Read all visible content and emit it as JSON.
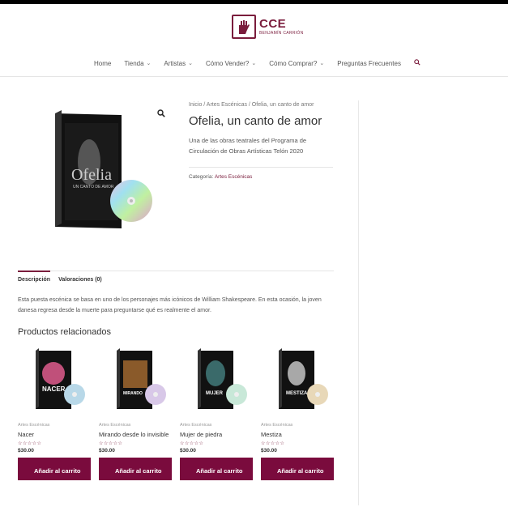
{
  "brand": {
    "name": "CCE",
    "sub": "BENJAMÍN CARRIÓN",
    "accent": "#7a1c3c"
  },
  "nav": {
    "items": [
      {
        "label": "Home",
        "dropdown": false
      },
      {
        "label": "Tienda",
        "dropdown": true
      },
      {
        "label": "Artistas",
        "dropdown": true
      },
      {
        "label": "Cómo Vender?",
        "dropdown": true
      },
      {
        "label": "Cómo Comprar?",
        "dropdown": true
      },
      {
        "label": "Preguntas Frecuentes",
        "dropdown": false
      }
    ],
    "search_icon": "search-icon"
  },
  "product": {
    "breadcrumb": "Inicio / Artes Escénicas / Ofelia, un canto de amor",
    "title": "Ofelia, un canto de amor",
    "short_description": "Una de las obras teatrales del Programa de Circulación de Obras Artísticas Telón 2020",
    "category_label": "Categoría:",
    "category": "Artes Escénicas",
    "image_title": "Ofelia",
    "image_subtitle": "UN CANTO DE AMOR"
  },
  "tabs": [
    {
      "label": "Descripción",
      "active": true
    },
    {
      "label": "Valoraciones (0)",
      "active": false
    }
  ],
  "description": "Esta puesta escénica se basa en uno de los personajes más icónicos de William Shakespeare. En esta ocasión, la joven danesa regresa desde la muerte para preguntarse qué es realmente el amor.",
  "related": {
    "title": "Productos relacionados",
    "items": [
      {
        "category": "Artes Escénicas",
        "name": "Nacer",
        "price": "$30.00",
        "button": "Añadir al carrito",
        "cover_text": "NACER",
        "tone": "#c0507a"
      },
      {
        "category": "Artes Escénicas",
        "name": "Mirando desde lo invisible",
        "price": "$30.00",
        "button": "Añadir al carrito",
        "cover_text": "MIRANDO",
        "tone": "#8a5a2a"
      },
      {
        "category": "Artes Escénicas",
        "name": "Mujer de piedra",
        "price": "$30.00",
        "button": "Añadir al carrito",
        "cover_text": "MUJER",
        "tone": "#3a6a6a"
      },
      {
        "category": "Artes Escénicas",
        "name": "Mestiza",
        "price": "$30.00",
        "button": "Añadir al carrito",
        "cover_text": "MESTIZA",
        "tone": "#a8a8a8"
      }
    ]
  }
}
